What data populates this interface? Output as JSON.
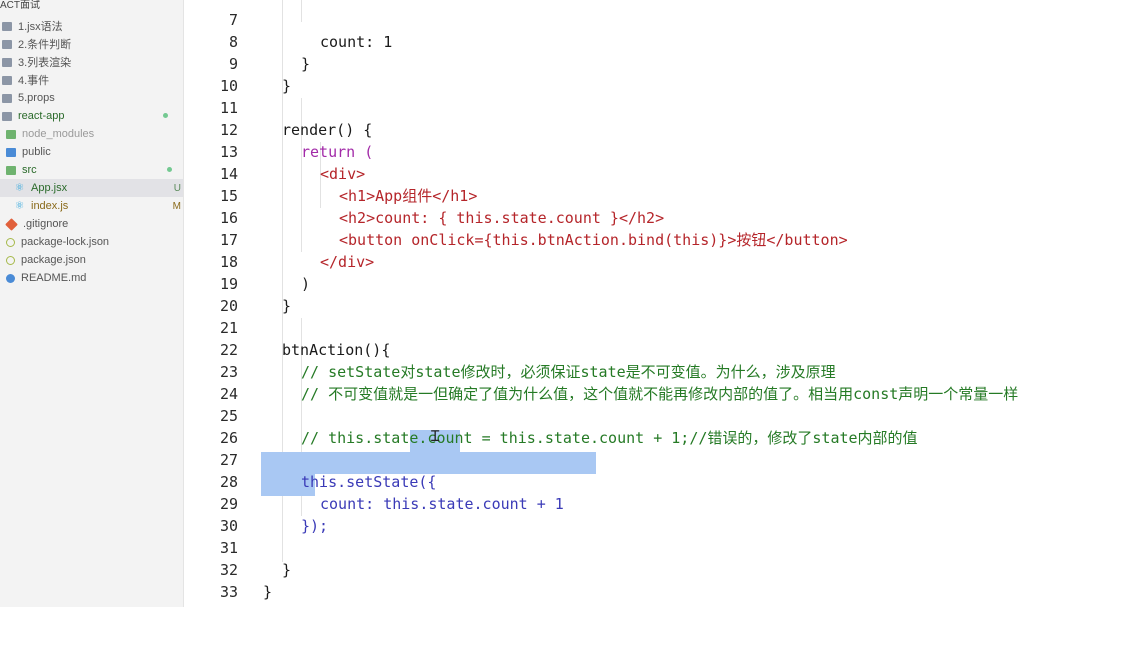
{
  "sidebar": {
    "root_label": "ACT面试",
    "items": [
      {
        "label": "1.jsx语法",
        "icon": "folder-icon"
      },
      {
        "label": "2.条件判断",
        "icon": "folder-icon"
      },
      {
        "label": "3.列表渲染",
        "icon": "folder-icon"
      },
      {
        "label": "4.事件",
        "icon": "folder-icon"
      },
      {
        "label": "5.props",
        "icon": "folder-icon"
      },
      {
        "label": "react-app",
        "icon": "folder-icon"
      },
      {
        "label": "node_modules",
        "icon": "folder-icon"
      },
      {
        "label": "public",
        "icon": "folder-icon"
      },
      {
        "label": "src",
        "icon": "folder-icon"
      },
      {
        "label": "App.jsx",
        "icon": "react-icon",
        "badge": "U"
      },
      {
        "label": "index.js",
        "icon": "react-icon",
        "badge": "M"
      },
      {
        "label": ".gitignore",
        "icon": "git-icon"
      },
      {
        "label": "package-lock.json",
        "icon": "json-icon"
      },
      {
        "label": "package.json",
        "icon": "json-icon"
      },
      {
        "label": "README.md",
        "icon": "info-icon"
      }
    ]
  },
  "editor": {
    "lines": [
      {
        "num": "7",
        "text": "count: 1"
      },
      {
        "num": "8",
        "text": "}"
      },
      {
        "num": "9",
        "text": "}"
      },
      {
        "num": "10",
        "text": ""
      },
      {
        "num": "11",
        "text": "render() {"
      },
      {
        "num": "12",
        "text": "return ("
      },
      {
        "num": "13",
        "text": "<div>"
      },
      {
        "num": "14",
        "text": "<h1>App组件</h1>"
      },
      {
        "num": "15",
        "text": "<h2>count: { this.state.count }</h2>"
      },
      {
        "num": "16",
        "text": "<button onClick={this.btnAction.bind(this)}>按钮</button>"
      },
      {
        "num": "17",
        "text": "</div>"
      },
      {
        "num": "18",
        "text": ")"
      },
      {
        "num": "19",
        "text": "}"
      },
      {
        "num": "20",
        "text": ""
      },
      {
        "num": "21",
        "text": "btnAction(){"
      },
      {
        "num": "22",
        "text": "// setState对state修改时，必须保证state是不可变值。为什么，涉及原理"
      },
      {
        "num": "23",
        "text": "// 不可变值就是一但确定了值为什么值，这个值就不能再修改内部的值了。相当用const声明一个常量一样"
      },
      {
        "num": "24",
        "text": ""
      },
      {
        "num": "25",
        "text": "// this.state.count = this.state.count + 1;//错误的，修改了state内部的值"
      },
      {
        "num": "26",
        "text": ""
      },
      {
        "num": "27",
        "text": "this.setState({"
      },
      {
        "num": "28",
        "text": "count: this.state.count + 1"
      },
      {
        "num": "29",
        "text": "});"
      },
      {
        "num": "30",
        "text": ""
      },
      {
        "num": "31",
        "text": "}"
      },
      {
        "num": "32",
        "text": "}"
      },
      {
        "num": "33",
        "text": ""
      }
    ]
  },
  "colors": {
    "keyword": "#a22aa8",
    "tag": "#b5252a",
    "member": "#3a3ab7",
    "comment": "#257a25",
    "selection": "#a9c8f3",
    "git_untracked_dot": "#73c991"
  }
}
